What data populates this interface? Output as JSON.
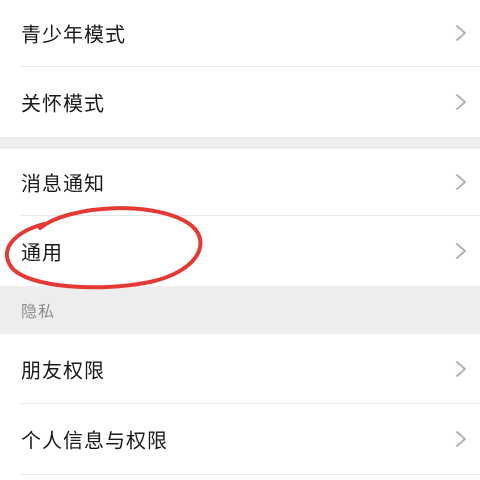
{
  "settings": {
    "items": [
      {
        "label": "青少年模式",
        "icon": "chevron-right-icon"
      },
      {
        "label": "关怀模式",
        "icon": "chevron-right-icon"
      },
      {
        "label": "消息通知",
        "icon": "chevron-right-icon"
      },
      {
        "label": "通用",
        "icon": "chevron-right-icon"
      }
    ],
    "privacy": {
      "header": "隐私",
      "items": [
        {
          "label": "朋友权限",
          "icon": "chevron-right-icon"
        },
        {
          "label": "个人信息与权限",
          "icon": "chevron-right-icon"
        }
      ]
    }
  },
  "colors": {
    "background": "#ffffff",
    "section_gap": "#ededed",
    "text": "#1a1a1a",
    "muted_text": "#8c8c8c",
    "chevron": "#b2b2b2",
    "annotation": "#e53935"
  }
}
